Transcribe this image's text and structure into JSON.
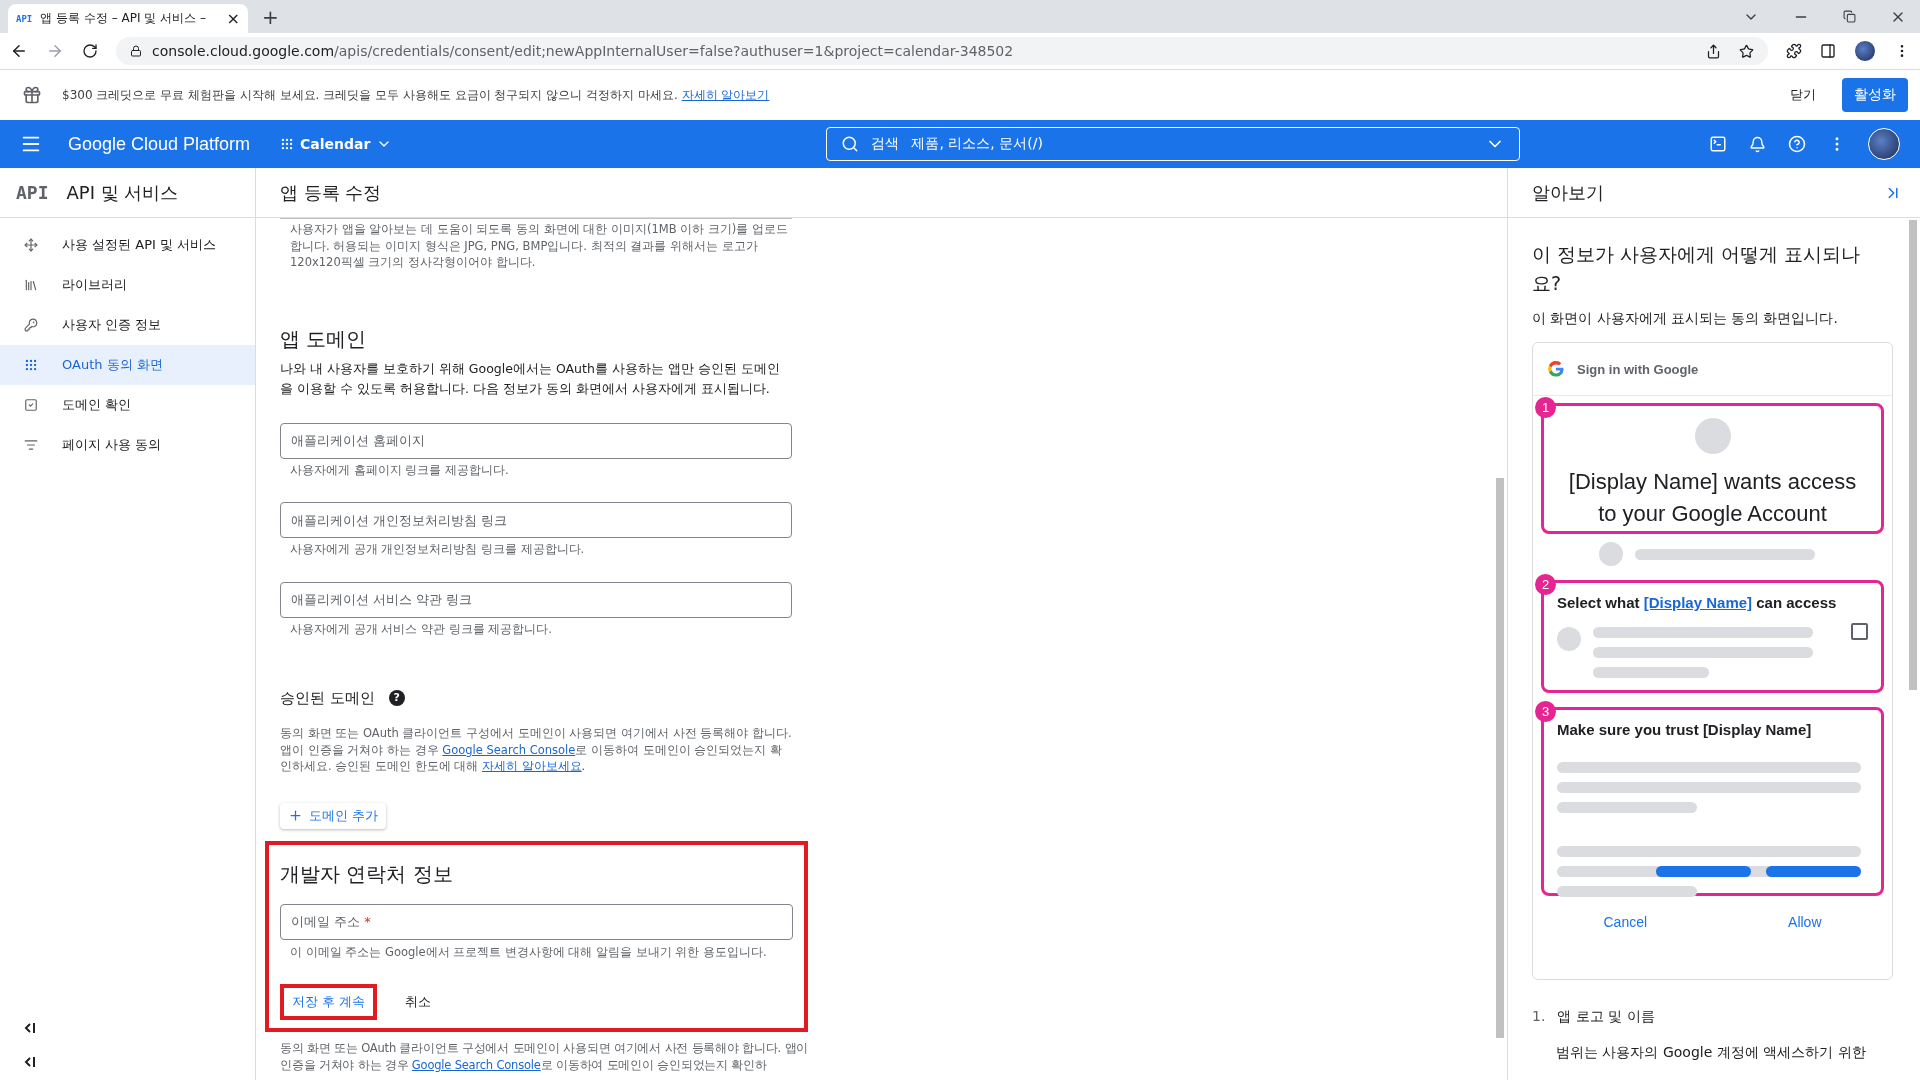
{
  "browser": {
    "tab": {
      "favicon": "API",
      "title": "앱 등록 수정 – API 및 서비스 –",
      "close": "×"
    },
    "new_tab": "+",
    "url_host": "console.cloud.google.com",
    "url_path": "/apis/credentials/consent/edit;newAppInternalUser=false?authuser=1&project=calendar-348502"
  },
  "banner": {
    "text": "$300 크레딧으로 무료 체험판을 시작해 보세요. 크레딧을 모두 사용해도 요금이 청구되지 않으니 걱정하지 마세요.",
    "link": "자세히 알아보기",
    "close": "닫기",
    "activate": "활성화"
  },
  "header": {
    "product": "Google Cloud Platform",
    "project": "Calendar",
    "search": {
      "label": "검색",
      "placeholder": "제품, 리소스, 문서(/)"
    }
  },
  "sidebar": {
    "logo": "API",
    "title": "API 및 서비스",
    "items": [
      {
        "label": "사용 설정된 API 및 서비스",
        "selected": false
      },
      {
        "label": "라이브러리",
        "selected": false
      },
      {
        "label": "사용자 인증 정보",
        "selected": false
      },
      {
        "label": "OAuth 동의 화면",
        "selected": true
      },
      {
        "label": "도메인 확인",
        "selected": false
      },
      {
        "label": "페이지 사용 동의",
        "selected": false
      }
    ]
  },
  "main": {
    "title": "앱 등록 수정",
    "logo_hint": "사용자가 앱을 알아보는 데 도움이 되도록 동의 화면에 대한 이미지(1MB 이하 크기)를 업로드합니다. 허용되는 이미지 형식은 JPG, PNG, BMP입니다. 최적의 결과를 위해서는 로고가 120x120픽셀 크기의 정사각형이어야 합니다.",
    "app_domain": {
      "heading": "앱 도메인",
      "description": "나와 내 사용자를 보호하기 위해 Google에서는 OAuth를 사용하는 앱만 승인된 도메인을 이용할 수 있도록 허용합니다. 다음 정보가 동의 화면에서 사용자에게 표시됩니다.",
      "fields": [
        {
          "placeholder": "애플리케이션 홈페이지",
          "helper": "사용자에게 홈페이지 링크를 제공합니다."
        },
        {
          "placeholder": "애플리케이션 개인정보처리방침 링크",
          "helper": "사용자에게 공개 개인정보처리방침 링크를 제공합니다."
        },
        {
          "placeholder": "애플리케이션 서비스 약관 링크",
          "helper": "사용자에게 공개 서비스 약관 링크를 제공합니다."
        }
      ]
    },
    "authorized_domains": {
      "heading": "승인된 도메인",
      "help": "?",
      "description": [
        {
          "kind": "text",
          "text": "동의 화면 또는 OAuth 클라이언트 구성에서 도메인이 사용되면 여기에서 사전 등록해야 합니다. 앱이 인증을 거쳐야 하는 경우 "
        },
        {
          "kind": "link",
          "text": "Google Search Console"
        },
        {
          "kind": "text",
          "text": "로 이동하여 도메인이 승인되었는지 확인하세요. 승인된 도메인 한도에 대해 "
        },
        {
          "kind": "link",
          "text": "자세히 알아보세요"
        },
        {
          "kind": "text",
          "text": "."
        }
      ],
      "add_button": "도메인 추가"
    },
    "developer_contact": {
      "highlighted": true,
      "heading": "개발자 연락처 정보",
      "email_placeholder": "이메일 주소",
      "required_mark": "*",
      "helper": "이 이메일 주소는 Google에서 프로젝트 변경사항에 대해 알림을 보내기 위한 용도입니다.",
      "save_button": {
        "label": "저장 후 계속",
        "highlighted": true
      },
      "cancel_button": "취소"
    },
    "footer_text": [
      {
        "kind": "text",
        "text": "동의 화면 또는 OAuth 클라이언트 구성에서 도메인이 사용되면 여기에서 사전 등록해야 합니다. 앱이 인증을 거쳐야 하는 경우 "
      },
      {
        "kind": "link",
        "text": "Google Search Console"
      },
      {
        "kind": "text",
        "text": "로 이동하여 도메인이 승인되었는지 확인하"
      }
    ]
  },
  "panel": {
    "title": "알아보기",
    "question": "이 정보가 사용자에게 어떻게 표시되나요?",
    "subtitle": "이 화면이 사용자에게 표시되는 동의 화면입니다.",
    "preview": {
      "header": "Sign in with Google",
      "steps": [
        {
          "kind": "identity",
          "number": "1",
          "title": [
            {
              "kind": "text",
              "text": "[Display Name] wants access to your Google Account"
            }
          ]
        },
        {
          "kind": "scopes",
          "number": "2",
          "checked": false,
          "title": [
            {
              "kind": "text",
              "text": "Select what "
            },
            {
              "kind": "link",
              "text": "[Display Name]"
            },
            {
              "kind": "text",
              "text": " can access"
            }
          ]
        },
        {
          "kind": "trust",
          "number": "3",
          "title": [
            {
              "kind": "text",
              "text": "Make sure you trust [Display Name]"
            }
          ]
        }
      ],
      "cancel": "Cancel",
      "allow": "Allow"
    },
    "list": [
      {
        "number": "1.",
        "title": "앱 로고 및 이름"
      }
    ],
    "scope_text": "범위는 사용자의 Google 계정에 액세스하기 위한"
  }
}
